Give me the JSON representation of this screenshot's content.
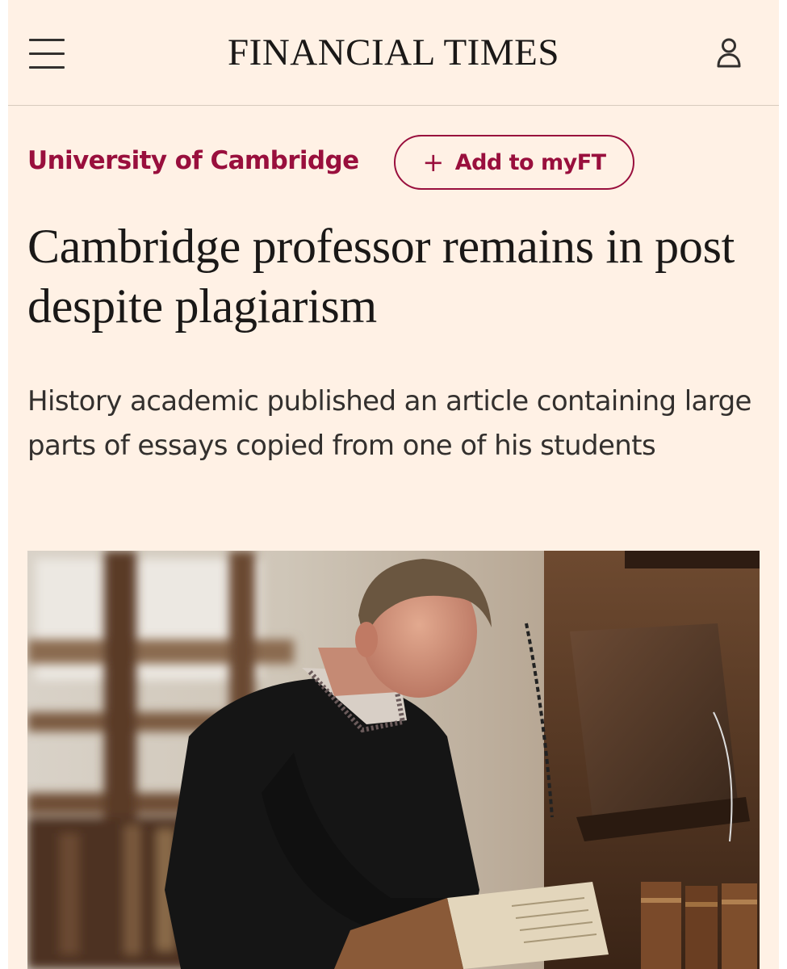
{
  "header": {
    "brand": "FINANCIAL TIMES",
    "menu_icon": "hamburger-menu-icon",
    "user_icon": "user-account-icon"
  },
  "topic": {
    "label": "University of Cambridge",
    "follow_button": {
      "icon": "plus-icon",
      "label": "Add to myFT"
    }
  },
  "article": {
    "headline": "Cambridge professor remains in post despite plagiarism",
    "standfirst": "History academic published an article containing large parts of essays copied from one of his students"
  },
  "colors": {
    "background": "#fff1e5",
    "accent": "#990f3d",
    "text": "#1a1817"
  }
}
